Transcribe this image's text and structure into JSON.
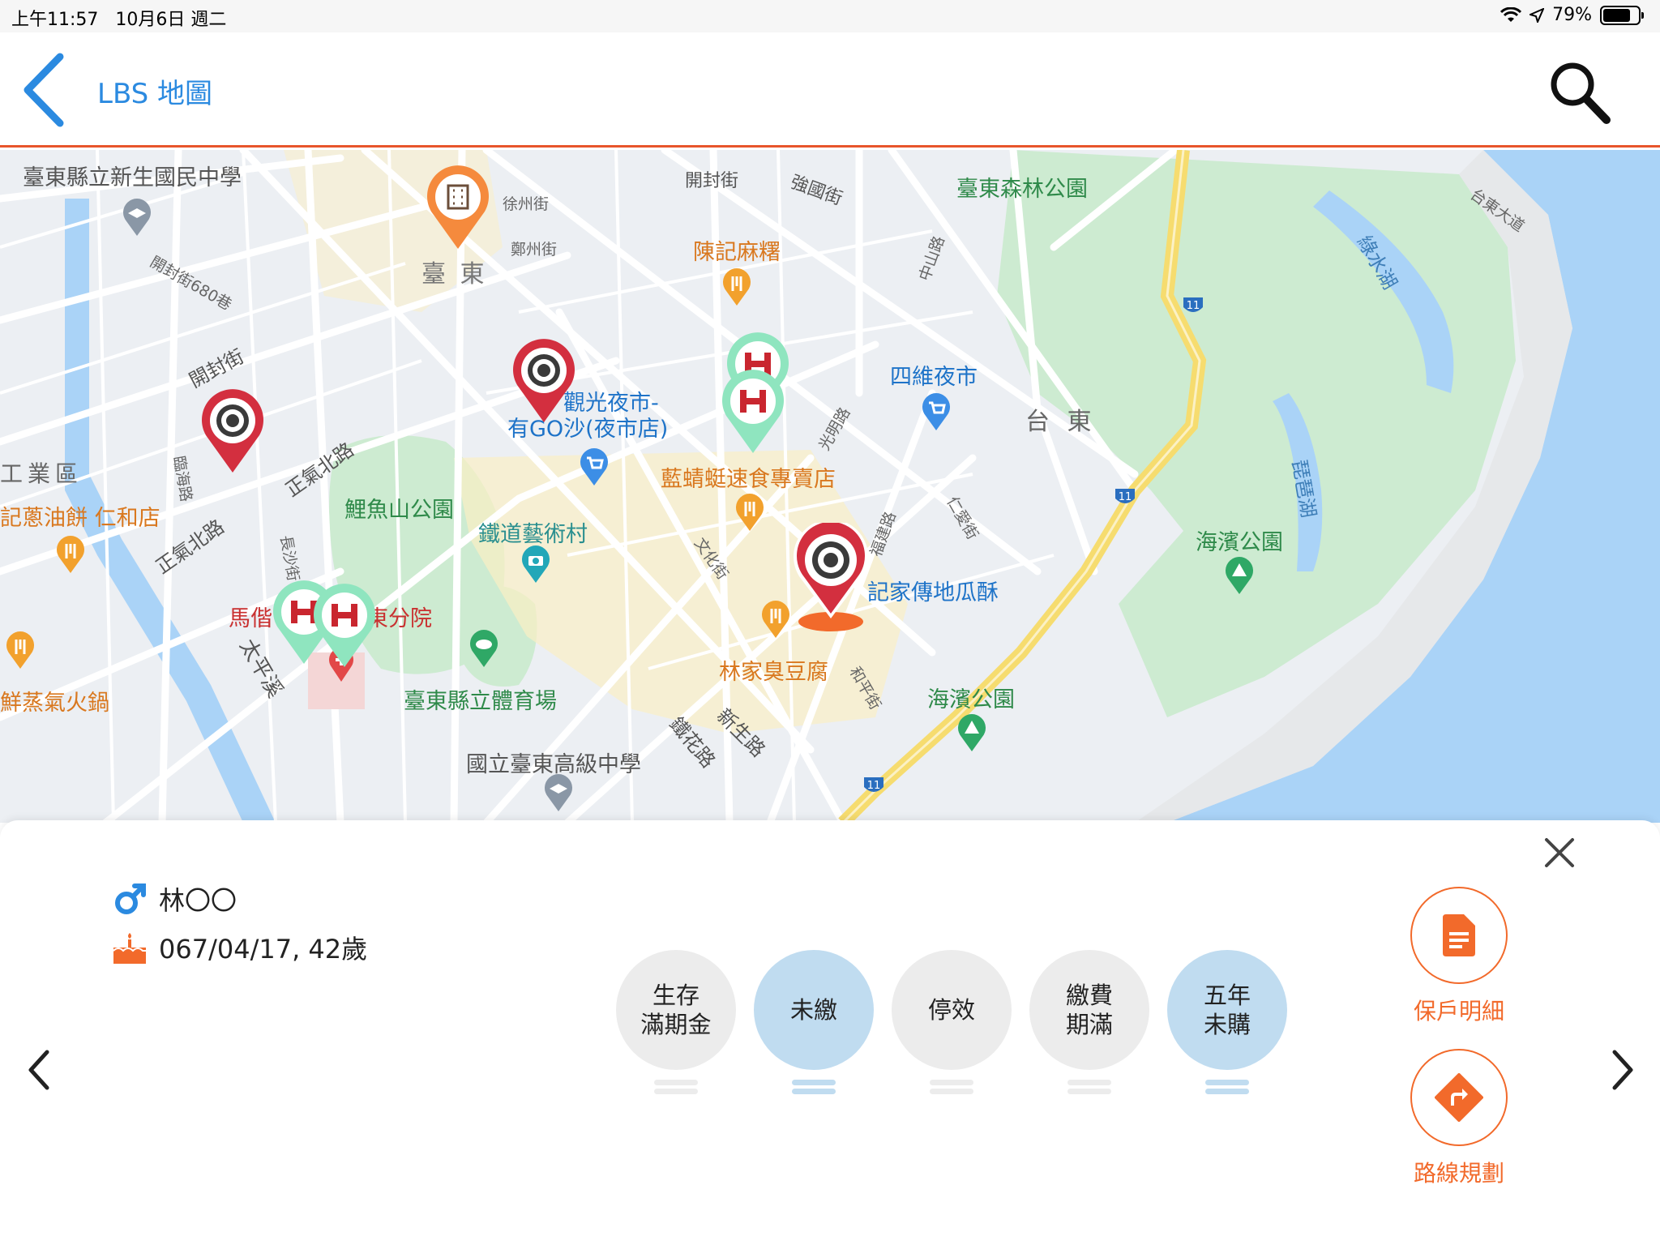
{
  "statusbar": {
    "time": "上午11:57",
    "date": "10月6日 週二",
    "battery": "79%",
    "battery_level": 0.79
  },
  "navbar": {
    "title": "LBS 地圖"
  },
  "map": {
    "labels": {
      "school1": "臺東縣立新生國民中學",
      "kaifeng1": "開封街",
      "qiangguo": "強國街",
      "forest_park": "臺東森林公園",
      "lake": "琵琶湖",
      "luyhu": "綠水湖",
      "taidong_avenue": "台東大道",
      "kaifeng680": "開封街680巷",
      "chen_mahua": "陳記麻糬",
      "taitung_center": "臺 東",
      "siwei_market": "四維夜市",
      "taidong_dist": "台 東",
      "kaifeng2": "開封街",
      "night_market1": "觀光夜市-",
      "night_market2": "有GO沙(夜市店)",
      "industrial": "工業區",
      "zhengqi_n": "正氣北路",
      "lanjingting": "藍蜻蜓速食專賣店",
      "scallion_pie": "記蔥油餅 仁和店",
      "liyu_park": "鯉魚山公園",
      "railway_art": "鐵道藝術村",
      "zhengqi_n2": "正氣北路",
      "sweet_potato": "記家傳地瓜酥",
      "seaside_park1": "海濱公園",
      "mackay": "馬偕",
      "taidong_branch": "台東分院",
      "lin_tofu": "林家臭豆腐",
      "hotpot": "鮮蒸氣火鍋",
      "stadium": "臺東縣立體育場",
      "seaside_park2": "海濱公園",
      "taiping": "太平溪",
      "xinsheng": "新生路",
      "tiehua": "鐵花路",
      "high_school": "國立臺東高級中學",
      "route11": "11",
      "xuzhou": "徐州街",
      "zhengzhou": "鄭州街",
      "zhongshan": "中山路",
      "guangming": "光明路",
      "wenhua": "文化街",
      "fujian": "福建路",
      "renai": "仁愛街",
      "chengdu": "長沙街",
      "linhai": "臨海路",
      "heping": "和平街"
    }
  },
  "customer": {
    "gender_icon": "male-icon",
    "name": "林〇〇",
    "birth": "067/04/17, 42歲"
  },
  "tags": [
    {
      "label": "生存\n滿期金",
      "active": false
    },
    {
      "label": "未繳",
      "active": true
    },
    {
      "label": "停效",
      "active": false
    },
    {
      "label": "繳費\n期滿",
      "active": false
    },
    {
      "label": "五年\n未購",
      "active": true
    }
  ],
  "actions": {
    "detail_label": "保戶明細",
    "route_label": "路線規劃"
  },
  "colors": {
    "accent": "#f26a2b",
    "nav_blue": "#2b8ae0",
    "chip_active": "#c0dcf0",
    "chip_inactive": "#ececec",
    "pin_red": "#d32f3f",
    "pin_green": "#5fd6a3"
  }
}
